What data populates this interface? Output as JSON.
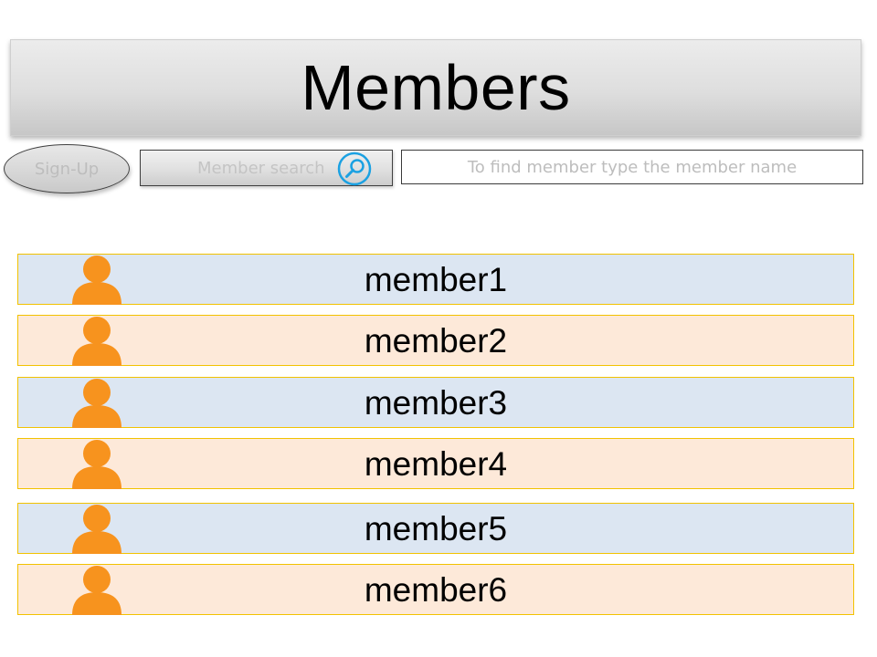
{
  "header": {
    "title": "Members"
  },
  "toolbar": {
    "signup_label": "Sign-Up",
    "search_button_label": "Member search",
    "search_icon": "magnifier-icon",
    "search_placeholder": "To find member type the member name"
  },
  "members": [
    {
      "name": "member1",
      "style": "blue",
      "icon": "person-icon"
    },
    {
      "name": "member2",
      "style": "peach",
      "icon": "person-icon"
    },
    {
      "name": "member3",
      "style": "blue",
      "icon": "person-icon"
    },
    {
      "name": "member4",
      "style": "peach",
      "icon": "person-icon"
    },
    {
      "name": "member5",
      "style": "blue",
      "icon": "person-icon"
    },
    {
      "name": "member6",
      "style": "peach",
      "icon": "person-icon"
    }
  ],
  "colors": {
    "row_blue": "#dce6f2",
    "row_peach": "#fde9d9",
    "row_border": "#f2c200",
    "avatar_orange": "#f7931e",
    "search_icon_blue": "#1ba1e2"
  }
}
